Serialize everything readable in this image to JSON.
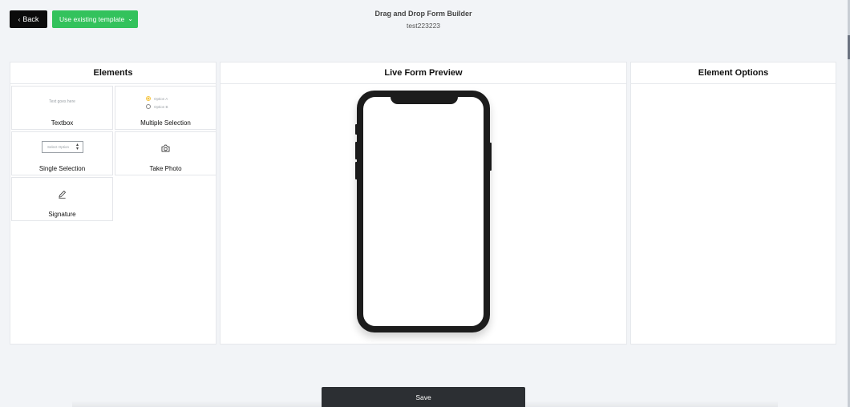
{
  "header": {
    "back_label": "Back",
    "template_label": "Use existing template",
    "title": "Drag and Drop Form Builder",
    "subtitle": "test223223"
  },
  "panels": {
    "elements_title": "Elements",
    "preview_title": "Live Form Preview",
    "options_title": "Element Options"
  },
  "elements": {
    "textbox": {
      "label": "Textbox",
      "preview_text": "Text goes here"
    },
    "multiple": {
      "label": "Multiple Selection",
      "option_a": "Option A",
      "option_b": "Option B"
    },
    "single": {
      "label": "Single Selection",
      "placeholder": "Select Option"
    },
    "photo": {
      "label": "Take Photo",
      "icon": "camera-icon"
    },
    "signature": {
      "label": "Signature",
      "icon": "pen-icon"
    }
  },
  "footer": {
    "save_label": "Save"
  },
  "colors": {
    "back_button": "#0b0b0b",
    "template_button": "#33c25c",
    "save_button": "#2c2f33",
    "radio_selected": "#f5c542"
  }
}
